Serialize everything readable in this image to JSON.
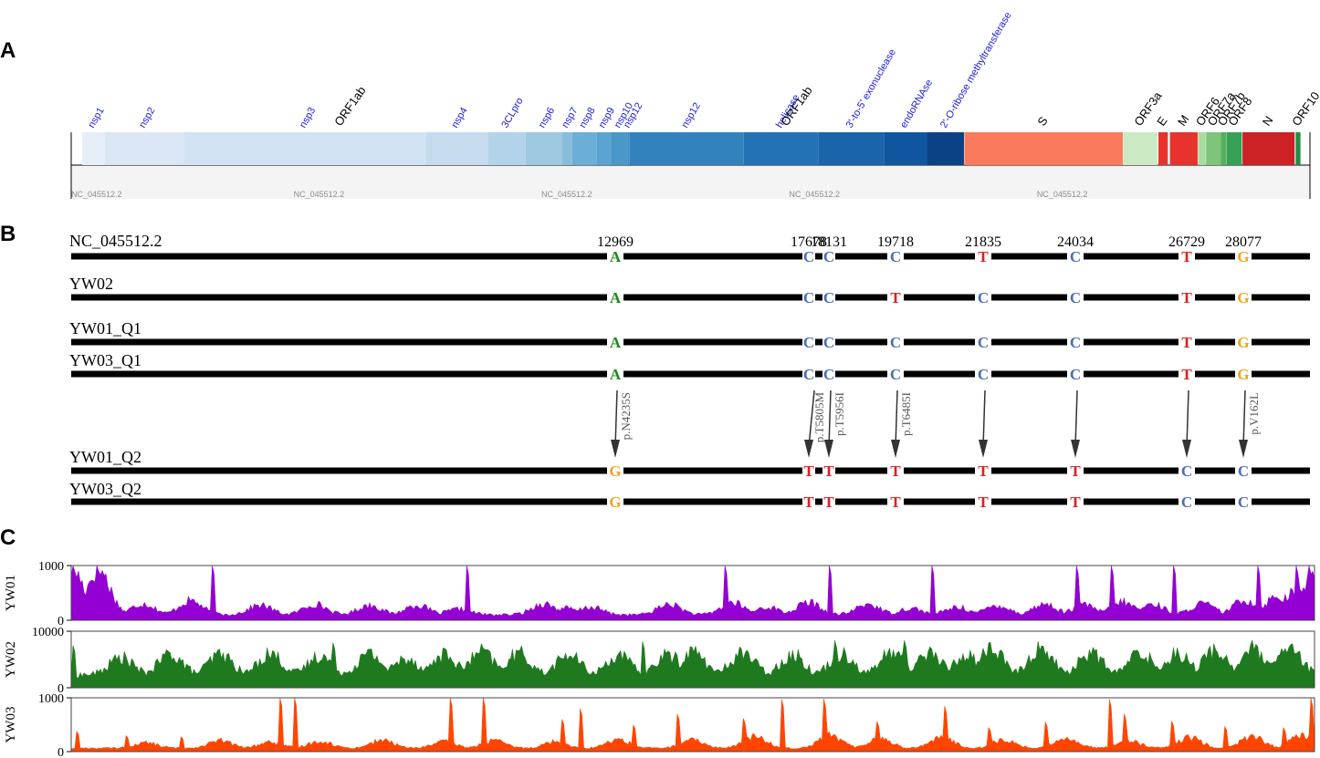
{
  "panels": {
    "a": "A",
    "b": "B",
    "c": "C"
  },
  "genome": {
    "length": 29903,
    "track_label": "NC_045512.2",
    "genes": [
      {
        "name": "ORF1ab",
        "start": 1,
        "end": 13000,
        "color": "none"
      },
      {
        "name": "ORF1ab",
        "start": 13000,
        "end": 21555,
        "color": "none"
      },
      {
        "name": "S",
        "start": 21563,
        "end": 25384,
        "color": "#f97a5c"
      },
      {
        "name": "ORF3a",
        "start": 25393,
        "end": 26220,
        "color": "#cbe9c3"
      },
      {
        "name": "E",
        "start": 26245,
        "end": 26472,
        "color": "#e8322d"
      },
      {
        "name": "M",
        "start": 26523,
        "end": 27191,
        "color": "#e8322d"
      },
      {
        "name": "ORF6",
        "start": 27202,
        "end": 27387,
        "color": "#a9dba0"
      },
      {
        "name": "ORF7a",
        "start": 27394,
        "end": 27759,
        "color": "#7cc57a"
      },
      {
        "name": "ORF7b",
        "start": 27756,
        "end": 27887,
        "color": "#52b05e"
      },
      {
        "name": "ORF8",
        "start": 27894,
        "end": 28259,
        "color": "#36a055"
      },
      {
        "name": "N",
        "start": 28274,
        "end": 29533,
        "color": "#cd2126"
      },
      {
        "name": "ORF10",
        "start": 29558,
        "end": 29674,
        "color": "#238b45"
      }
    ],
    "subfeatures": [
      {
        "name": "nsp1",
        "start": 266,
        "end": 805,
        "color": "#e6eef8"
      },
      {
        "name": "nsp2",
        "start": 806,
        "end": 2719,
        "color": "#dbe7f5"
      },
      {
        "name": "nsp3",
        "start": 2720,
        "end": 8554,
        "color": "#d2e3f3"
      },
      {
        "name": "nsp4",
        "start": 8555,
        "end": 10054,
        "color": "#c7dbef"
      },
      {
        "name": "3CLpro",
        "start": 10055,
        "end": 10972,
        "color": "#b3d3e9"
      },
      {
        "name": "nsp6",
        "start": 10973,
        "end": 11842,
        "color": "#9dcae1"
      },
      {
        "name": "nsp7",
        "start": 11843,
        "end": 12091,
        "color": "#88bedc"
      },
      {
        "name": "nsp8",
        "start": 12092,
        "end": 12685,
        "color": "#6baed6"
      },
      {
        "name": "nsp9",
        "start": 12686,
        "end": 13024,
        "color": "#5ba3d0"
      },
      {
        "name": "nsp10",
        "start": 13025,
        "end": 13441,
        "color": "#4a98c9"
      },
      {
        "name": "nsp12",
        "start": 13442,
        "end": 13480,
        "color": "#3d8dc3"
      },
      {
        "name": "nsp12",
        "start": 13481,
        "end": 16236,
        "color": "#3282be"
      },
      {
        "name": "helicase",
        "start": 16237,
        "end": 18039,
        "color": "#2372b6"
      },
      {
        "name": "3'-to-5' exonuclease",
        "start": 18040,
        "end": 19620,
        "color": "#1964aa"
      },
      {
        "name": "endoRNAse",
        "start": 19621,
        "end": 20658,
        "color": "#0f56a0"
      },
      {
        "name": "2'-O-ribose methyltransferase",
        "start": 20659,
        "end": 21552,
        "color": "#0b4285"
      }
    ]
  },
  "alignment": {
    "positions": [
      "12969",
      "17678",
      "18131",
      "19718",
      "21835",
      "24034",
      "26729",
      "28077"
    ],
    "base_colors": {
      "A": "#1a8a1a",
      "C": "#4a6fb5",
      "G": "#f2a21a",
      "T": "#e01f1f"
    },
    "sequences": [
      {
        "name": "NC_045512.2",
        "bases": [
          "A",
          "C",
          "C",
          "C",
          "T",
          "C",
          "T",
          "G"
        ]
      },
      {
        "name": "YW02",
        "bases": [
          "A",
          "C",
          "C",
          "T",
          "C",
          "C",
          "T",
          "G"
        ]
      },
      {
        "name": "YW01_Q1",
        "bases": [
          "A",
          "C",
          "C",
          "C",
          "C",
          "C",
          "T",
          "G"
        ]
      },
      {
        "name": "YW03_Q1",
        "bases": [
          "A",
          "C",
          "C",
          "C",
          "C",
          "C",
          "T",
          "G"
        ]
      },
      {
        "name": "YW01_Q2",
        "bases": [
          "G",
          "T",
          "T",
          "T",
          "T",
          "T",
          "C",
          "C"
        ]
      },
      {
        "name": "YW03_Q2",
        "bases": [
          "G",
          "T",
          "T",
          "T",
          "T",
          "T",
          "C",
          "C"
        ]
      }
    ],
    "aa_changes": [
      "p.N4235S",
      "p.T5805M",
      "p.T5956I",
      "p.T6485I",
      "",
      "",
      "",
      "p.V162L"
    ]
  },
  "coverage": [
    {
      "name": "YW01",
      "ymax": 1000,
      "ticks": [
        "1000",
        "0"
      ],
      "color": "#9400d3",
      "base": 110,
      "peaks": [
        [
          0.001,
          1000
        ],
        [
          0.022,
          1000
        ],
        [
          0.058,
          330
        ],
        [
          0.096,
          390
        ],
        [
          0.152,
          300
        ],
        [
          0.196,
          320
        ],
        [
          0.24,
          300
        ],
        [
          0.278,
          300
        ],
        [
          0.312,
          220
        ],
        [
          0.38,
          330
        ],
        [
          0.397,
          240
        ],
        [
          0.418,
          260
        ],
        [
          0.481,
          320
        ],
        [
          0.532,
          350
        ],
        [
          0.56,
          260
        ],
        [
          0.593,
          350
        ],
        [
          0.641,
          320
        ],
        [
          0.675,
          240
        ],
        [
          0.713,
          260
        ],
        [
          0.745,
          300
        ],
        [
          0.783,
          320
        ],
        [
          0.815,
          300
        ],
        [
          0.846,
          360
        ],
        [
          0.87,
          320
        ],
        [
          0.91,
          330
        ],
        [
          0.944,
          400
        ],
        [
          0.97,
          480
        ],
        [
          0.985,
          600
        ],
        [
          0.998,
          820
        ]
      ],
      "spikes": [
        [
          0.001,
          1000
        ],
        [
          0.114,
          1000
        ],
        [
          0.318,
          1000
        ],
        [
          0.526,
          1000
        ],
        [
          0.61,
          1000
        ],
        [
          0.692,
          1000
        ],
        [
          0.808,
          1000
        ],
        [
          0.836,
          1000
        ],
        [
          0.886,
          1000
        ],
        [
          0.954,
          1000
        ],
        [
          0.985,
          1000
        ],
        [
          0.996,
          1000
        ]
      ]
    },
    {
      "name": "YW02",
      "ymax": 10000,
      "ticks": [
        "10000",
        "0"
      ],
      "color": "#1f7a1f",
      "base": 2500,
      "peaks": [
        [
          0.04,
          5800
        ],
        [
          0.08,
          6500
        ],
        [
          0.12,
          6400
        ],
        [
          0.16,
          6600
        ],
        [
          0.2,
          6200
        ],
        [
          0.24,
          6500
        ],
        [
          0.27,
          5700
        ],
        [
          0.3,
          6300
        ],
        [
          0.33,
          6900
        ],
        [
          0.36,
          6600
        ],
        [
          0.4,
          6300
        ],
        [
          0.44,
          6200
        ],
        [
          0.48,
          6300
        ],
        [
          0.5,
          7000
        ],
        [
          0.54,
          6800
        ],
        [
          0.58,
          6400
        ],
        [
          0.62,
          6600
        ],
        [
          0.66,
          6800
        ],
        [
          0.69,
          6800
        ],
        [
          0.72,
          6300
        ],
        [
          0.74,
          7600
        ],
        [
          0.78,
          7600
        ],
        [
          0.82,
          6700
        ],
        [
          0.86,
          6700
        ],
        [
          0.89,
          6700
        ],
        [
          0.92,
          7200
        ],
        [
          0.95,
          7400
        ],
        [
          0.98,
          7500
        ]
      ],
      "spikes": [
        [
          0.002,
          7500
        ],
        [
          0.21,
          8000
        ],
        [
          0.46,
          8200
        ],
        [
          0.614,
          8400
        ],
        [
          0.67,
          8400
        ]
      ]
    },
    {
      "name": "YW03",
      "ymax": 1000,
      "ticks": [
        "1000",
        "0"
      ],
      "color": "#ff4500",
      "base": 70,
      "peaks": [
        [
          0.06,
          180
        ],
        [
          0.12,
          220
        ],
        [
          0.16,
          190
        ],
        [
          0.2,
          210
        ],
        [
          0.25,
          230
        ],
        [
          0.3,
          200
        ],
        [
          0.34,
          220
        ],
        [
          0.39,
          210
        ],
        [
          0.44,
          240
        ],
        [
          0.5,
          230
        ],
        [
          0.55,
          300
        ],
        [
          0.61,
          330
        ],
        [
          0.65,
          280
        ],
        [
          0.7,
          290
        ],
        [
          0.75,
          230
        ],
        [
          0.8,
          280
        ],
        [
          0.85,
          230
        ],
        [
          0.9,
          280
        ],
        [
          0.95,
          300
        ],
        [
          0.99,
          320
        ]
      ],
      "spikes": [
        [
          0.004,
          380
        ],
        [
          0.044,
          300
        ],
        [
          0.089,
          280
        ],
        [
          0.168,
          1000
        ],
        [
          0.179,
          1000
        ],
        [
          0.305,
          1000
        ],
        [
          0.332,
          1000
        ],
        [
          0.395,
          600
        ],
        [
          0.409,
          800
        ],
        [
          0.452,
          500
        ],
        [
          0.488,
          700
        ],
        [
          0.54,
          620
        ],
        [
          0.572,
          970
        ],
        [
          0.606,
          980
        ],
        [
          0.648,
          560
        ],
        [
          0.703,
          850
        ],
        [
          0.738,
          450
        ],
        [
          0.784,
          550
        ],
        [
          0.835,
          970
        ],
        [
          0.847,
          700
        ],
        [
          0.885,
          570
        ],
        [
          0.928,
          470
        ],
        [
          0.975,
          450
        ],
        [
          0.997,
          1000
        ]
      ]
    }
  ]
}
